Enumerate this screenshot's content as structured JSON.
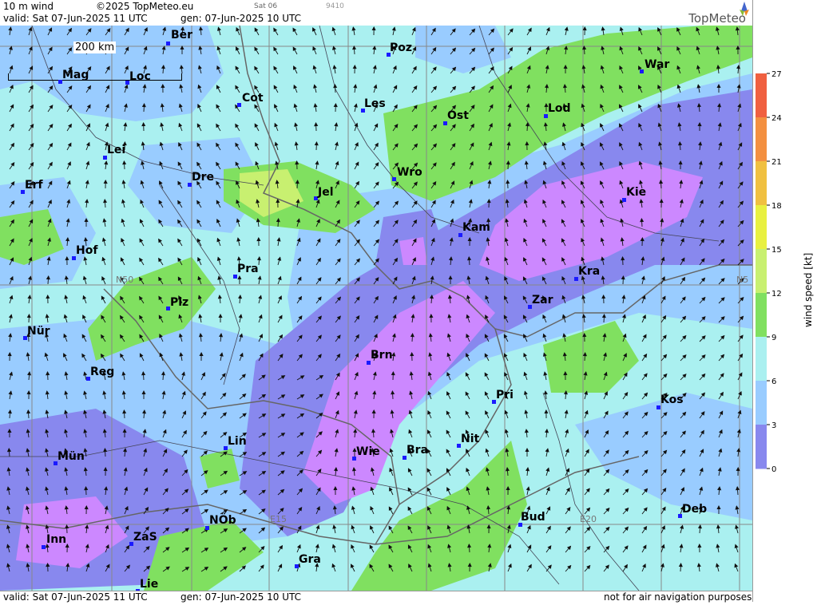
{
  "header": {
    "product": "10 m wind",
    "copyright": "©2025 TopMeteo.eu",
    "sat_label": "Sat 06",
    "code": "9410",
    "valid": "valid:  Sat  07-Jun-2025  11 UTC",
    "gen": "gen: 07-Jun-2025 10 UTC",
    "logo": "TopMeteo"
  },
  "footer": {
    "valid": "valid:  Sat  07-Jun-2025  11 UTC",
    "gen": "gen: 07-Jun-2025 10 UTC",
    "disclaimer": "not for air navigation purposes"
  },
  "scale_bar": "200 km",
  "grid_labels": {
    "n50_left": "N50",
    "n50_right": "N5",
    "e15": "E15",
    "e20": "E20"
  },
  "legend": {
    "title": "wind  speed  [kt]",
    "ticks": [
      "27",
      "24",
      "21",
      "18",
      "15",
      "12",
      "9",
      "6",
      "3",
      "0"
    ],
    "colors": [
      "#f06040",
      "#f39040",
      "#f0c040",
      "#e8f040",
      "#c8f070",
      "#80e060",
      "#aaf0f0",
      "#99ccff",
      "#8888ee",
      "#cc88ff"
    ]
  },
  "cities": [
    {
      "name": "Ber"
    },
    {
      "name": "Poz"
    },
    {
      "name": "Mag"
    },
    {
      "name": "Loc"
    },
    {
      "name": "Cot"
    },
    {
      "name": "Les"
    },
    {
      "name": "Ost"
    },
    {
      "name": "Lod"
    },
    {
      "name": "War"
    },
    {
      "name": "Lei"
    },
    {
      "name": "Erf"
    },
    {
      "name": "Dre"
    },
    {
      "name": "Jel"
    },
    {
      "name": "Wro"
    },
    {
      "name": "Kie"
    },
    {
      "name": "Kam"
    },
    {
      "name": "Hof"
    },
    {
      "name": "Pra"
    },
    {
      "name": "Kra"
    },
    {
      "name": "Plz"
    },
    {
      "name": "Zar"
    },
    {
      "name": "Nür"
    },
    {
      "name": "Brn"
    },
    {
      "name": "Reg"
    },
    {
      "name": "Pri"
    },
    {
      "name": "Kos"
    },
    {
      "name": "Lin"
    },
    {
      "name": "Nit"
    },
    {
      "name": "Mün"
    },
    {
      "name": "Wie"
    },
    {
      "name": "Bra"
    },
    {
      "name": "Bud"
    },
    {
      "name": "Deb"
    },
    {
      "name": "NÖb"
    },
    {
      "name": "Inn"
    },
    {
      "name": "ZaS"
    },
    {
      "name": "Gra"
    },
    {
      "name": "Lie"
    }
  ]
}
